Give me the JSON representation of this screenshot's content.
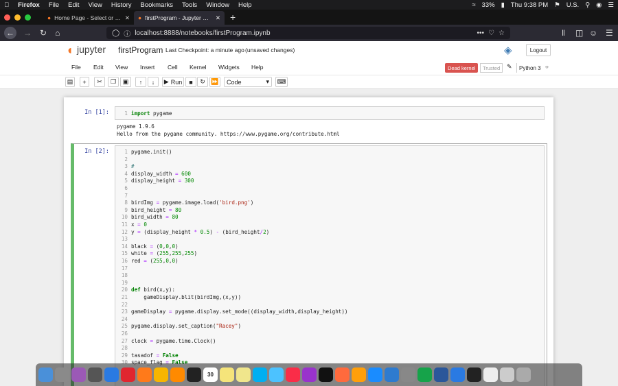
{
  "mac_menu": {
    "apple": "",
    "app": "Firefox",
    "items": [
      "File",
      "Edit",
      "View",
      "History",
      "Bookmarks",
      "Tools",
      "Window",
      "Help"
    ],
    "battery": "33%",
    "clock": "Thu 9:38 PM",
    "locale": "U.S."
  },
  "tabs": [
    {
      "title": "Home Page - Select or create a"
    },
    {
      "title": "firstProgram - Jupyter Notebook"
    }
  ],
  "new_tab": "+",
  "nav": {
    "url": "localhost:8888/notebooks/firstProgram.ipynb",
    "more": "•••"
  },
  "jupyter": {
    "logo": "jupyter",
    "title": "firstProgram",
    "checkpoint": "Last Checkpoint: a minute ago",
    "unsaved": "(unsaved changes)",
    "logout": "Logout",
    "menu": [
      "File",
      "Edit",
      "View",
      "Insert",
      "Cell",
      "Kernel",
      "Widgets",
      "Help"
    ],
    "dead_kernel": "Dead kernel",
    "trusted": "Trusted",
    "kernel_name": "Python 3",
    "run_label": "Run",
    "cell_type": "Code"
  },
  "colors": {
    "dead_kernel": "#d9534f",
    "active_cell": "#66bb6a",
    "prompt": "#303f9f"
  },
  "cells": [
    {
      "prompt": "In [1]:",
      "lines": [
        [
          "import pygame"
        ]
      ],
      "output": [
        "pygame 1.9.6",
        "Hello from the pygame community. https://www.pygame.org/contribute.html"
      ]
    },
    {
      "prompt": "In [2]:",
      "lines": [
        "pygame.init()",
        "",
        "#",
        "display_width = 600",
        "display_height = 300",
        "",
        "",
        "birdImg = pygame.image.load('bird.png')",
        "bird_height = 80",
        "bird_width = 80",
        "x = 0",
        "y = (display_height * 0.5) - (bird_height/2)",
        "",
        "black = (0,0,0)",
        "white = (255,255,255)",
        "red = (255,0,0)",
        "",
        "",
        "",
        "def bird(x,y):",
        "    gameDisplay.blit(birdImg,(x,y))",
        "",
        "gameDisplay = pygame.display.set_mode((display_width,display_height))",
        "",
        "pygame.display.set_caption(\"Racey\")",
        "",
        "clock = pygame.time.Clock()",
        "",
        "tasadof = False",
        "space_flag = False"
      ]
    }
  ],
  "dock": [
    "Finder",
    "Downloads",
    "Siri",
    "Launchpad",
    "Safari",
    "Opera",
    "Firefox",
    "Sketch",
    "Sublime",
    "GitHub",
    "30",
    "Notes",
    "Stickies",
    "Skype",
    "Messages",
    "Music",
    "Podcasts",
    "TV",
    "DeX",
    "Books",
    "App Store",
    "Xcode",
    "Prefs",
    "Vim",
    "Word",
    "Safari2",
    "Terminal",
    "Doc",
    "Archive",
    "Trash"
  ]
}
